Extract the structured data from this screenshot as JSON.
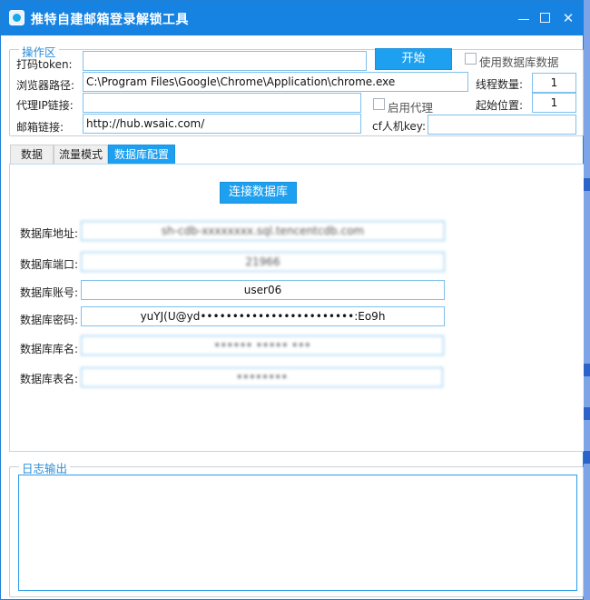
{
  "window": {
    "title": "推特自建邮箱登录解锁工具",
    "controls": {
      "minimize": "─",
      "maximize": "□",
      "close": "✕"
    }
  },
  "operation": {
    "legend": "操作区",
    "token_label": "打码token:",
    "token_value": "",
    "start_button": "开始",
    "use_db_label": "使用数据库数据",
    "browser_label": "浏览器路径:",
    "browser_value": "C:\\Program Files\\Google\\Chrome\\Application\\chrome.exe",
    "threads_label": "线程数量:",
    "threads_value": "1",
    "proxy_label": "代理IP链接:",
    "proxy_value": "",
    "enable_proxy_label": "启用代理",
    "start_pos_label": "起始位置:",
    "start_pos_value": "1",
    "mail_label": "邮箱链接:",
    "mail_value": "http://hub.wsaic.com/",
    "cf_label": "cf人机key:",
    "cf_value": ""
  },
  "tabs": [
    {
      "label": "数据",
      "active": false
    },
    {
      "label": "流量模式",
      "active": false
    },
    {
      "label": "数据库配置",
      "active": true
    }
  ],
  "db": {
    "connect_button": "连接数据库",
    "host_label": "数据库地址:",
    "host_value": "sh-cdb-xxxxxxxx.sql.tencentcdb.com",
    "port_label": "数据库端口:",
    "port_value": "21966",
    "user_label": "数据库账号:",
    "user_value": "user06",
    "password_label": "数据库密码:",
    "password_value": "yuYJ(U@yd••••••••••••••••••••••••:Eo9h",
    "dbname_label": "数据库库名:",
    "dbname_value": "•••••• ••••• •••",
    "table_label": "数据库表名:",
    "table_value": "••••••••"
  },
  "log": {
    "legend": "日志输出",
    "content": ""
  },
  "colors": {
    "accent": "#1ea0f0",
    "titlebar": "#1683e3",
    "legend": "#2a8cd8"
  }
}
